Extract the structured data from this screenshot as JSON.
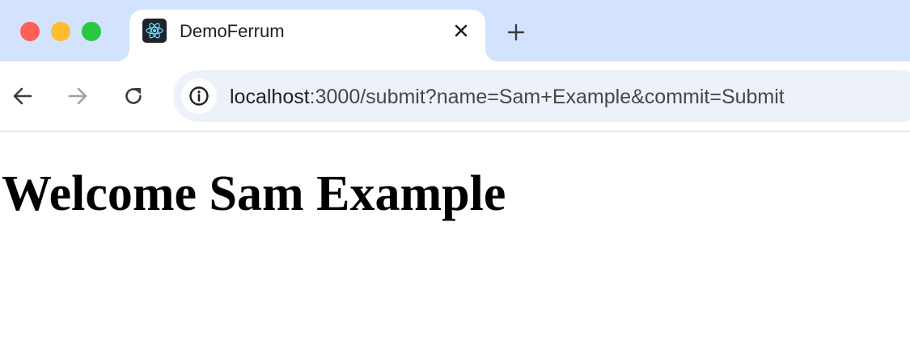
{
  "window": {
    "traffic_lights": [
      "close",
      "minimize",
      "zoom"
    ]
  },
  "tab": {
    "title": "DemoFerrum",
    "favicon": "react-atom-icon",
    "close_icon": "close-icon"
  },
  "new_tab": {
    "icon": "plus-icon"
  },
  "toolbar": {
    "back_icon": "arrow-left-icon",
    "forward_icon": "arrow-right-icon",
    "reload_icon": "reload-icon"
  },
  "address_bar": {
    "info_icon": "info-icon",
    "url_host": "localhost",
    "url_rest": ":3000/submit?name=Sam+Example&commit=Submit"
  },
  "page": {
    "heading": "Welcome Sam Example"
  },
  "colors": {
    "tab_strip": "#d3e3fd",
    "omnibox": "#edf2fa",
    "react_blue": "#61dafb"
  }
}
